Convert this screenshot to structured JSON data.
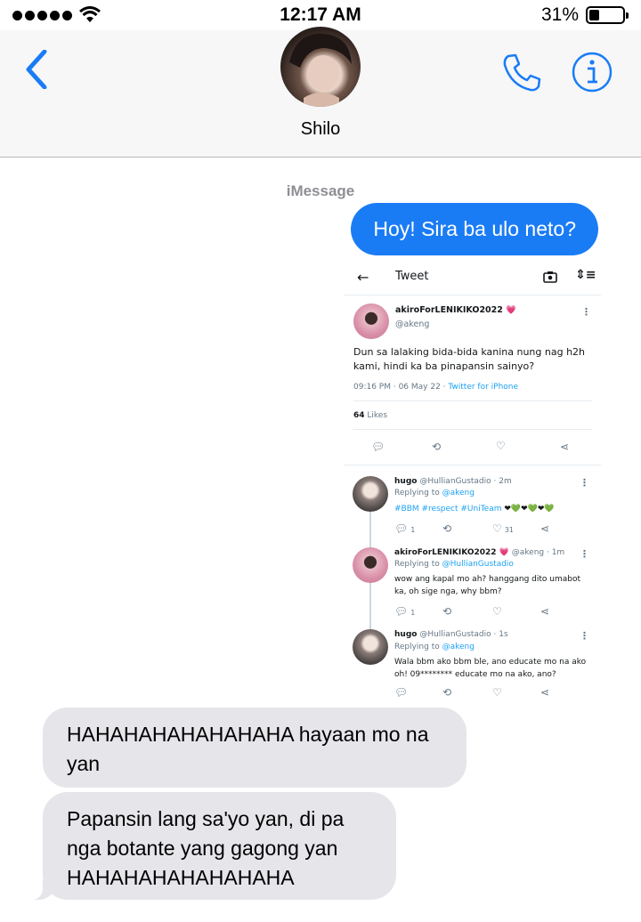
{
  "status": {
    "time": "12:17 AM",
    "battery_pct": "31%",
    "battery_level": 0.31
  },
  "header": {
    "contact_name": "Shilo"
  },
  "conversation": {
    "service_label": "iMessage",
    "sent": [
      {
        "text": "Hoy! Sira ba ulo neto?"
      }
    ],
    "received": [
      {
        "text": "HAHAHAHAHAHAHAHA hayaan mo na yan"
      },
      {
        "text": "Papansin lang sa'yo yan, di pa nga botante yang gagong yan HAHAHAHAHAHAHAHA"
      }
    ]
  },
  "tweet": {
    "header_title": "Tweet",
    "author_name": "akiroForLENIKIKO2022 💗",
    "author_handle": "@akeng",
    "body": "Dun sa lalaking bida-bida kanina nung nag h2h kami, hindi ka ba pinapansin sainyo?",
    "time": "09:16 PM · 06 May 22 · ",
    "source": "Twitter for iPhone",
    "likes_count": "64",
    "likes_label": " Likes",
    "replies": [
      {
        "name": "hugo",
        "handle": "@HullianGustadio · 2m",
        "replying_label": "Replying to ",
        "replying_to": "@akeng",
        "hashtags": "#BBM #respect #UniTeam",
        "hearts": "❤💚❤💚❤💚",
        "reply_count": "1",
        "like_count": "31"
      },
      {
        "name": "akiroForLENIKIKO2022 💗",
        "handle": "@akeng · 1m",
        "replying_label": "Replying to ",
        "replying_to": "@HullianGustadio",
        "text_line1": "wow ang kapal mo ah? hanggang dito umabot",
        "text_line2": "ka, oh sige nga, why bbm?",
        "reply_count": "1"
      },
      {
        "name": "hugo",
        "handle": "@HullianGustadio · 1s",
        "replying_label": "Replying to ",
        "replying_to": "@akeng",
        "text_line1": "Wala bbm ako bbm ble, ano educate mo na ako",
        "text_line2": "oh! 09******** educate mo na ako, ano?"
      }
    ]
  },
  "colors": {
    "accent": "#1a7cf5",
    "received_bubble": "#e5e5ea",
    "twitter_blue": "#1da1f2"
  }
}
